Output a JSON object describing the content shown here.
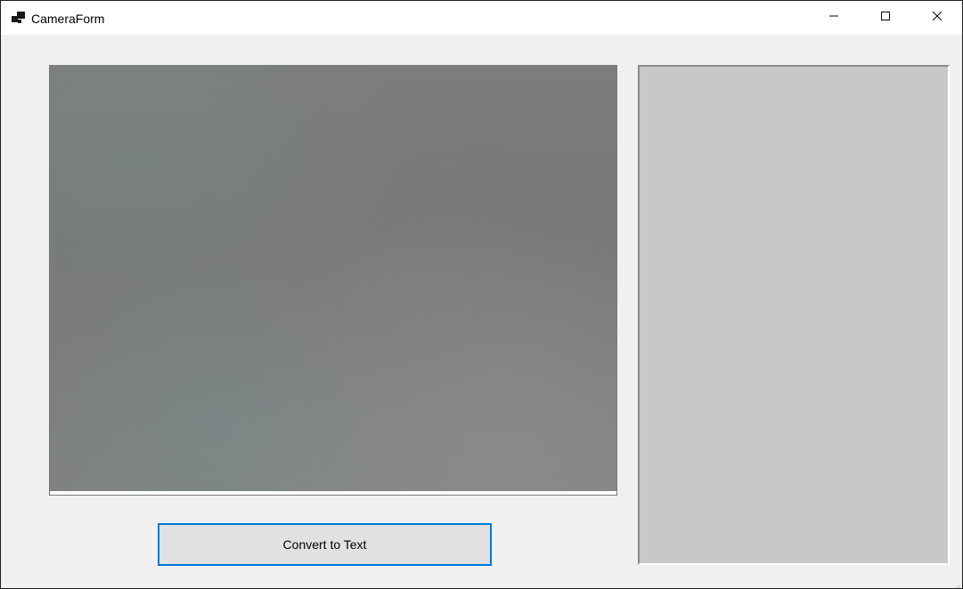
{
  "window": {
    "title": "CameraForm",
    "app_icon": "form-icon"
  },
  "caption_buttons": {
    "minimize_icon": "minimize-icon",
    "maximize_icon": "maximize-icon",
    "close_icon": "close-icon"
  },
  "main": {
    "convert_button_label": "Convert to Text"
  },
  "colors": {
    "accent": "#0078d7",
    "form_background": "#f0f0f0",
    "result_panel_background": "#c8c8c8",
    "button_background": "#e1e1e1"
  }
}
